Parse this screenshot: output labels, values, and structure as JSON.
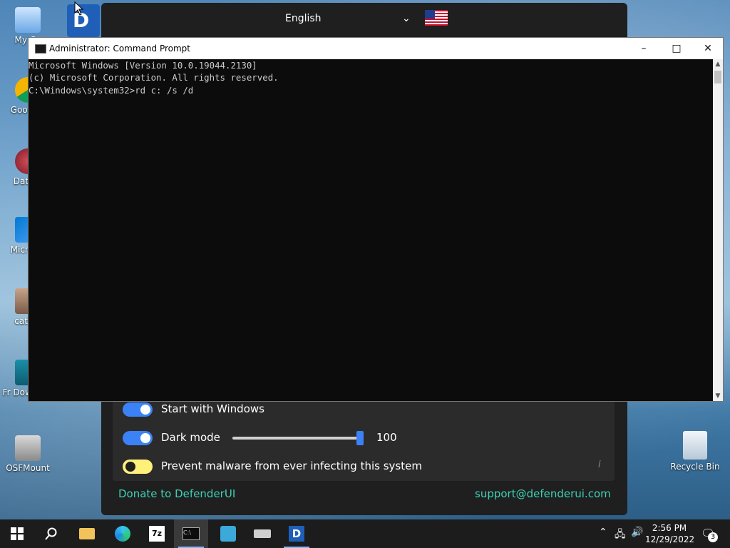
{
  "desktop": {
    "icons": [
      {
        "label": "My Co"
      },
      {
        "label": "Goo Chr"
      },
      {
        "label": "DataW"
      },
      {
        "label": "Micr Sto"
      },
      {
        "label": "cathy-"
      },
      {
        "label": "Fr Downlo..."
      },
      {
        "label": "OSFMount"
      },
      {
        "label": "Recycle Bin"
      }
    ]
  },
  "defender_ui": {
    "language": "English",
    "options": [
      {
        "label": "Start with Windows",
        "enabled": true
      },
      {
        "label": "Dark mode",
        "enabled": true
      },
      {
        "label": "Prevent malware from ever infecting this system",
        "enabled": false
      }
    ],
    "slider_value": "100",
    "donate_link": "Donate to DefenderUI",
    "support_link": "support@defenderui.com",
    "info_glyph": "i"
  },
  "cmd": {
    "title": "Administrator: Command Prompt",
    "lines": [
      "Microsoft Windows [Version 10.0.19044.2130]",
      "(c) Microsoft Corporation. All rights reserved.",
      "",
      "C:\\Windows\\system32>rd c: /s /d"
    ]
  },
  "taskbar": {
    "time": "2:56 PM",
    "date": "12/29/2022",
    "notification_count": "3",
    "apps": [
      "start",
      "search",
      "file-explorer",
      "edge",
      "7zip",
      "cmd",
      "app-installer",
      "drive",
      "defenderui"
    ]
  },
  "colors": {
    "accent_blue": "#3b82f6",
    "link_teal": "#3ed1b4",
    "toggle_yellow": "#fff07a"
  }
}
